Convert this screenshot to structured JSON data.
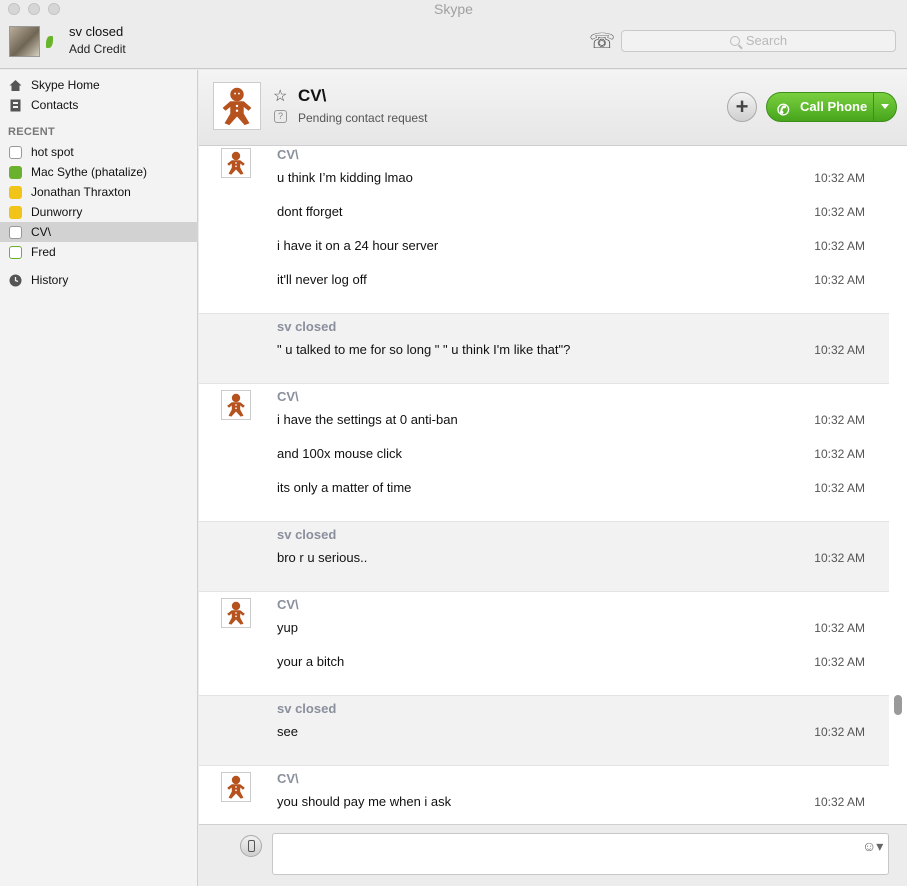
{
  "window": {
    "title": "Skype"
  },
  "toolbar": {
    "user_name": "sv closed",
    "add_credit": "Add Credit",
    "search_placeholder": "Search"
  },
  "sidebar": {
    "nav": [
      {
        "label": "Skype Home",
        "icon": "home-icon"
      },
      {
        "label": "Contacts",
        "icon": "contacts-book-icon"
      }
    ],
    "recent_header": "RECENT",
    "recent": [
      {
        "label": "hot spot",
        "status": "pending"
      },
      {
        "label": "Mac Sythe (phatalize)",
        "status": "online"
      },
      {
        "label": "Jonathan Thraxton",
        "status": "away"
      },
      {
        "label": "Dunworry",
        "status": "away"
      },
      {
        "label": "CV\\",
        "status": "pending",
        "selected": true
      },
      {
        "label": "Fred",
        "status": "online-outline"
      }
    ],
    "history": "History"
  },
  "conversation": {
    "contact_name": "CV\\",
    "subtitle": "Pending contact request",
    "call_button": "Call Phone"
  },
  "messages": [
    {
      "sender": "CV\\",
      "is_me": false,
      "lines": [
        {
          "text": "u think I’m kidding lmao",
          "time": "10:32 AM"
        },
        {
          "text": "dont fforget",
          "time": "10:32 AM"
        },
        {
          "text": "i have it on a 24 hour server",
          "time": "10:32 AM"
        },
        {
          "text": "it'll never log off",
          "time": "10:32 AM"
        }
      ]
    },
    {
      "sender": "sv closed",
      "is_me": true,
      "lines": [
        {
          "text": "\" u talked to me for so long \" \" u think I'm like that\"?",
          "time": "10:32 AM"
        }
      ]
    },
    {
      "sender": "CV\\",
      "is_me": false,
      "lines": [
        {
          "text": "i have the settings at 0 anti-ban",
          "time": "10:32 AM"
        },
        {
          "text": "and 100x mouse click",
          "time": "10:32 AM"
        },
        {
          "text": "its only a matter of time",
          "time": "10:32 AM"
        }
      ]
    },
    {
      "sender": "sv closed",
      "is_me": true,
      "lines": [
        {
          "text": "bro r u serious..",
          "time": "10:32 AM"
        }
      ]
    },
    {
      "sender": "CV\\",
      "is_me": false,
      "lines": [
        {
          "text": "yup",
          "time": "10:32 AM"
        },
        {
          "text": "your a bitch",
          "time": "10:32 AM"
        }
      ]
    },
    {
      "sender": "sv closed",
      "is_me": true,
      "lines": [
        {
          "text": "see",
          "time": "10:32 AM"
        }
      ]
    },
    {
      "sender": "CV\\",
      "is_me": false,
      "lines": [
        {
          "text": "you should pay me when i ask",
          "time": "10:32 AM"
        }
      ]
    }
  ],
  "composer": {
    "message_value": ""
  }
}
